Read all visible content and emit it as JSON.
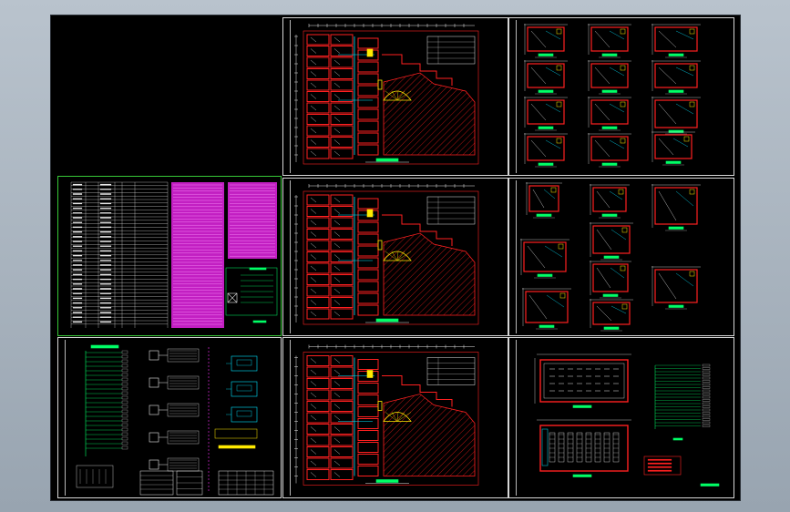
{
  "viewer": {
    "background": "#a7b2bd",
    "paper_color": "#000000"
  },
  "colors": {
    "wall": "#ff2020",
    "hatch": "#e01818",
    "dim": "#e8e8e8",
    "cyan": "#00e5ff",
    "yellow": "#ffea00",
    "green": "#00ff66",
    "magenta": "#ff33ff",
    "frame_green": "#37c837"
  },
  "sheets": [
    {
      "id": "blank",
      "kind": "empty"
    },
    {
      "id": "floor-plan-1",
      "kind": "floor-plan"
    },
    {
      "id": "room-details-1",
      "kind": "room-details"
    },
    {
      "id": "notes-schedule",
      "kind": "schedule",
      "highlight": "#ff33ff"
    },
    {
      "id": "floor-plan-2",
      "kind": "floor-plan"
    },
    {
      "id": "room-details-2",
      "kind": "room-details"
    },
    {
      "id": "system-diagram",
      "kind": "diagram"
    },
    {
      "id": "floor-plan-3",
      "kind": "floor-plan"
    },
    {
      "id": "hall-plan",
      "kind": "hall-plan"
    }
  ]
}
